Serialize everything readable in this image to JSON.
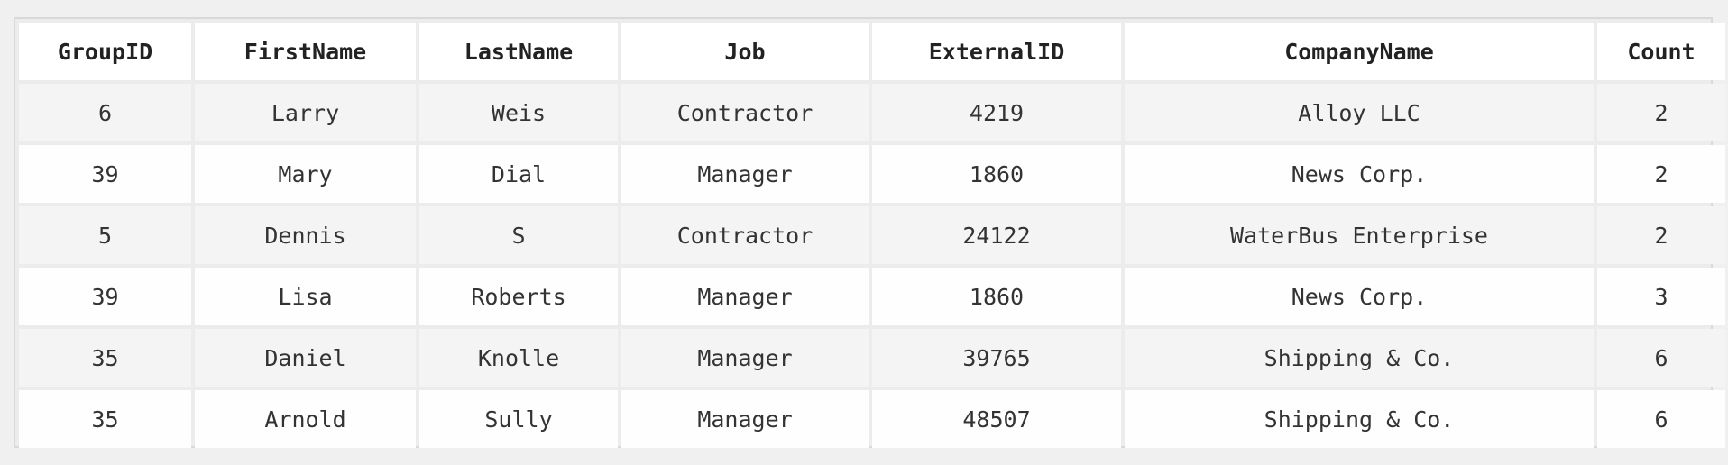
{
  "table": {
    "columns": [
      "GroupID",
      "FirstName",
      "LastName",
      "Job",
      "ExternalID",
      "CompanyName",
      "Count"
    ],
    "rows": [
      [
        "6",
        "Larry",
        "Weis",
        "Contractor",
        "4219",
        "Alloy LLC",
        "2"
      ],
      [
        "39",
        "Mary",
        "Dial",
        "Manager",
        "1860",
        "News Corp.",
        "2"
      ],
      [
        "5",
        "Dennis",
        "S",
        "Contractor",
        "24122",
        "WaterBus Enterprise",
        "2"
      ],
      [
        "39",
        "Lisa",
        "Roberts",
        "Manager",
        "1860",
        "News Corp.",
        "3"
      ],
      [
        "35",
        "Daniel",
        "Knolle",
        "Manager",
        "39765",
        "Shipping & Co.",
        "6"
      ],
      [
        "35",
        "Arnold",
        "Sully",
        "Manager",
        "48507",
        "Shipping & Co.",
        "6"
      ]
    ]
  },
  "colors": {
    "page_background": "#f0f0f0",
    "header_background": "#ffffff",
    "row_odd_background": "#f4f4f4",
    "row_even_background": "#fefefe",
    "text": "#333333"
  }
}
